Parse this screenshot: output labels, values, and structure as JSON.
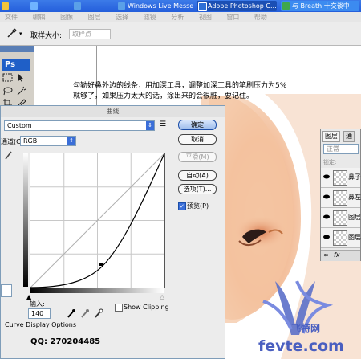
{
  "taskbar": {
    "items": [
      {
        "label": "",
        "color": "#f3c43c"
      },
      {
        "label": "",
        "color": "#6fb3ff"
      },
      {
        "label": "Windows Live Messe...",
        "color": "#5aa0e8"
      },
      {
        "label": "Adobe Photoshop C...",
        "color": "#2d6fd6"
      },
      {
        "label": "与 Breath 十交谈中",
        "color": "#3fa84b"
      }
    ]
  },
  "menubar": {
    "items": [
      "文件",
      "编辑",
      "图像",
      "图层",
      "选择",
      "滤镜",
      "分析",
      "视图",
      "窗口",
      "帮助"
    ]
  },
  "options": {
    "sample_label": "取样大小:",
    "sample_value": "取样点"
  },
  "toolbox": {
    "logo": "Ps"
  },
  "instruction": {
    "line1": "勾勒好鼻外边的线条，用加深工具，调整加深工具的笔刷压力为5%",
    "line2": "就够了，如果压力太大的话，涂出来的会很脏，要记住。"
  },
  "curves_dialog": {
    "title": "曲线",
    "preset_value": "Custom",
    "channel_label": "通道(C):",
    "channel_value": "RGB",
    "buttons": {
      "ok": "确定",
      "cancel": "取消",
      "smooth": "平滑(M)",
      "auto": "自动(A)",
      "options": "选项(T)..."
    },
    "preview_label": "预览(P)",
    "preview_checked": true,
    "input_label": "输入:",
    "input_value": "140",
    "show_clipping_label": "Show Clipping",
    "curve_display_options": "Curve Display Options",
    "accent_color": "#1c4ea8"
  },
  "layers_panel": {
    "tabs": [
      "图层",
      "通"
    ],
    "blend_mode": "正常",
    "lock_label": "锁定:",
    "layers": [
      {
        "name": "鼻子"
      },
      {
        "name": "鼻左"
      },
      {
        "name": "图层"
      },
      {
        "name": "图层"
      }
    ]
  },
  "watermark": {
    "site": "fevte.com",
    "cn": "飞特网"
  },
  "footer": {
    "qq": "QQ: 270204485"
  }
}
